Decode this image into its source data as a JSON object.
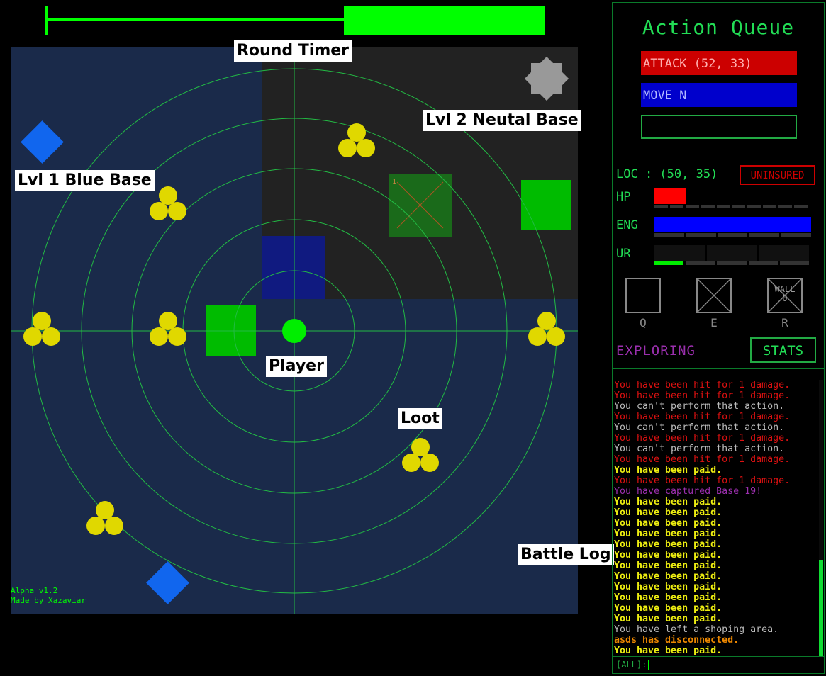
{
  "timer": {
    "progress": 0.59
  },
  "map": {
    "labels": {
      "round_timer": "Round Timer",
      "neutral_base": "Lvl 2 Neutal Base",
      "blue_base": "Lvl 1 Blue Base",
      "player": "Player",
      "loot": "Loot",
      "battle_log": "Battle Log"
    },
    "credits": {
      "version": "Alpha v1.2",
      "author": "Made by Xazaviar"
    },
    "colors": {
      "blue_zone": "#1a2a4a",
      "neutral_zone": "#222222",
      "grid": "#22bb44",
      "loot": "#e0d800",
      "player": "#00ee00",
      "blue_base": "#1166ee",
      "neutral_base": "#999999"
    }
  },
  "panel": {
    "action_queue": {
      "title": "Action Queue",
      "items": [
        "ATTACK (52, 33)",
        "MOVE N",
        ""
      ]
    },
    "loc_label": "LOC : (50, 35)",
    "insurance": "UNINSURED",
    "stats": {
      "hp": {
        "label": "HP",
        "fraction": 0.2,
        "color": "#ff0000"
      },
      "eng": {
        "label": "ENG",
        "fraction": 1.0,
        "color": "#0000ff"
      },
      "ur": {
        "label": "UR",
        "fraction": 0.0,
        "sub_fraction": 0.19
      }
    },
    "slots": [
      {
        "key": "Q",
        "text": "",
        "icon": "empty-slot"
      },
      {
        "key": "E",
        "text": "",
        "icon": "crossed-slot"
      },
      {
        "key": "R",
        "text": "WALL 0",
        "icon": "crossed-slot"
      }
    ],
    "mode": "EXPLORING",
    "stats_button": "STATS",
    "log": [
      {
        "text": "You have been hit for 1 damage.",
        "type": "red"
      },
      {
        "text": "You have been hit for 1 damage.",
        "type": "red"
      },
      {
        "text": "You can't perform that action.",
        "type": "grey"
      },
      {
        "text": "You have been hit for 1 damage.",
        "type": "red"
      },
      {
        "text": "You can't perform that action.",
        "type": "grey"
      },
      {
        "text": "You have been hit for 1 damage.",
        "type": "red"
      },
      {
        "text": "You can't perform that action.",
        "type": "grey"
      },
      {
        "text": "You have been hit for 1 damage.",
        "type": "red"
      },
      {
        "text": "You have been paid.",
        "type": "yellow"
      },
      {
        "text": "You have been hit for 1 damage.",
        "type": "red"
      },
      {
        "text": "You have captured Base 19!",
        "type": "purple"
      },
      {
        "text": "You have been paid.",
        "type": "yellow"
      },
      {
        "text": "You have been paid.",
        "type": "yellow"
      },
      {
        "text": "You have been paid.",
        "type": "yellow"
      },
      {
        "text": "You have been paid.",
        "type": "yellow"
      },
      {
        "text": "You have been paid.",
        "type": "yellow"
      },
      {
        "text": "You have been paid.",
        "type": "yellow"
      },
      {
        "text": "You have been paid.",
        "type": "yellow"
      },
      {
        "text": "You have been paid.",
        "type": "yellow"
      },
      {
        "text": "You have been paid.",
        "type": "yellow"
      },
      {
        "text": "You have been paid.",
        "type": "yellow"
      },
      {
        "text": "You have been paid.",
        "type": "yellow"
      },
      {
        "text": "You have been paid.",
        "type": "yellow"
      },
      {
        "text": "You have left a shoping area.",
        "type": "grey"
      },
      {
        "text": "asds has disconnected.",
        "type": "orange"
      },
      {
        "text": "You have been paid.",
        "type": "yellow"
      }
    ],
    "chat_prefix": "[ALL]:"
  }
}
